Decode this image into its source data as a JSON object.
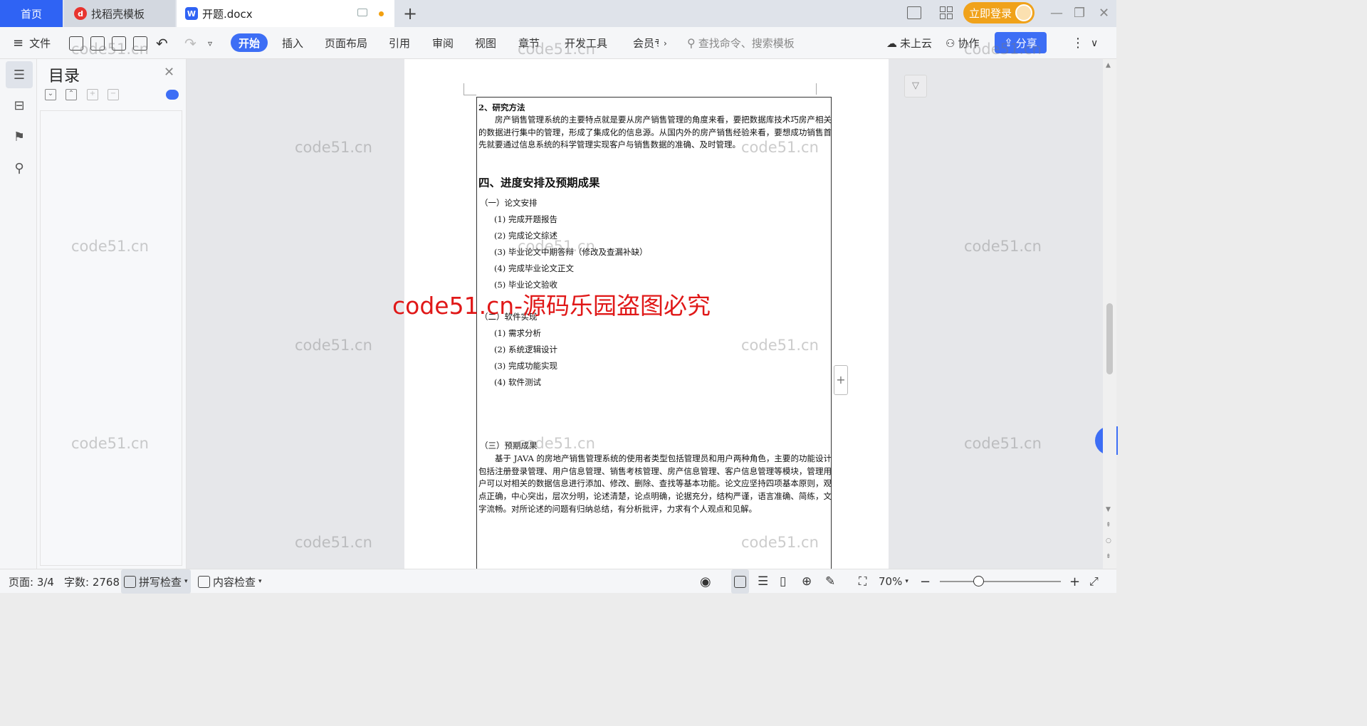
{
  "tabs": {
    "home": "首页",
    "template": "找稻壳模板",
    "doc": "开题.docx",
    "login": "立即登录"
  },
  "ribbon": {
    "file": "文件",
    "tabs": [
      "开始",
      "插入",
      "页面布局",
      "引用",
      "审阅",
      "视图",
      "章节",
      "开发工具",
      "会员专"
    ],
    "search_placeholder": "查找命令、搜索模板",
    "cloud": "未上云",
    "collab": "协作",
    "share": "分享"
  },
  "toc": {
    "title": "目录"
  },
  "document": {
    "method_heading": "2、研究方法",
    "method_para": "房产销售管理系统的主要特点就是要从房产销售管理的角度来看，要把数据库技术巧房产相关的数据进行集中的管理，形成了集成化的信息源。从国内外的房产销售经验来看，要想成功销售首先就要通过信息系统的科学管理实现客户与销售数据的准确、及时管理。",
    "section4": "四、进度安排及预期成果",
    "sub1": "（一）论文安排",
    "sub1_items": [
      "(1) 完成开题报告",
      "(2) 完成论文综述",
      "(3) 毕业论文中期答辩（修改及查漏补缺）",
      "(4) 完成毕业论文正文",
      "(5) 毕业论文验收"
    ],
    "sub2": "（二）软件实现",
    "sub2_items": [
      "(1) 需求分析",
      "(2) 系统逻辑设计",
      "(3) 完成功能实现",
      "(4) 软件测试"
    ],
    "sub3": "（三）预期成果",
    "result_para": "基于 JAVA 的房地产销售管理系统的使用者类型包括管理员和用户两种角色，主要的功能设计包括注册登录管理、用户信息管理、销售考核管理、房产信息管理、客户信息管理等模块，管理用户可以对相关的数据信息进行添加、修改、删除、查找等基本功能。论文应坚持四项基本原则，观点正确，中心突出，层次分明，论述清楚，论点明确，论据充分，结构严谨，语言准确、简练，文字流畅。对所论述的问题有归纳总结，有分析批评，力求有个人观点和见解。"
  },
  "watermark": {
    "text": "code51.cn",
    "red": "code51.cn-源码乐园盗图必究"
  },
  "status": {
    "page": "页面: 3/4",
    "words": "字数: 2768",
    "spell": "拼写检查",
    "content": "内容检查",
    "zoom": "70%"
  }
}
